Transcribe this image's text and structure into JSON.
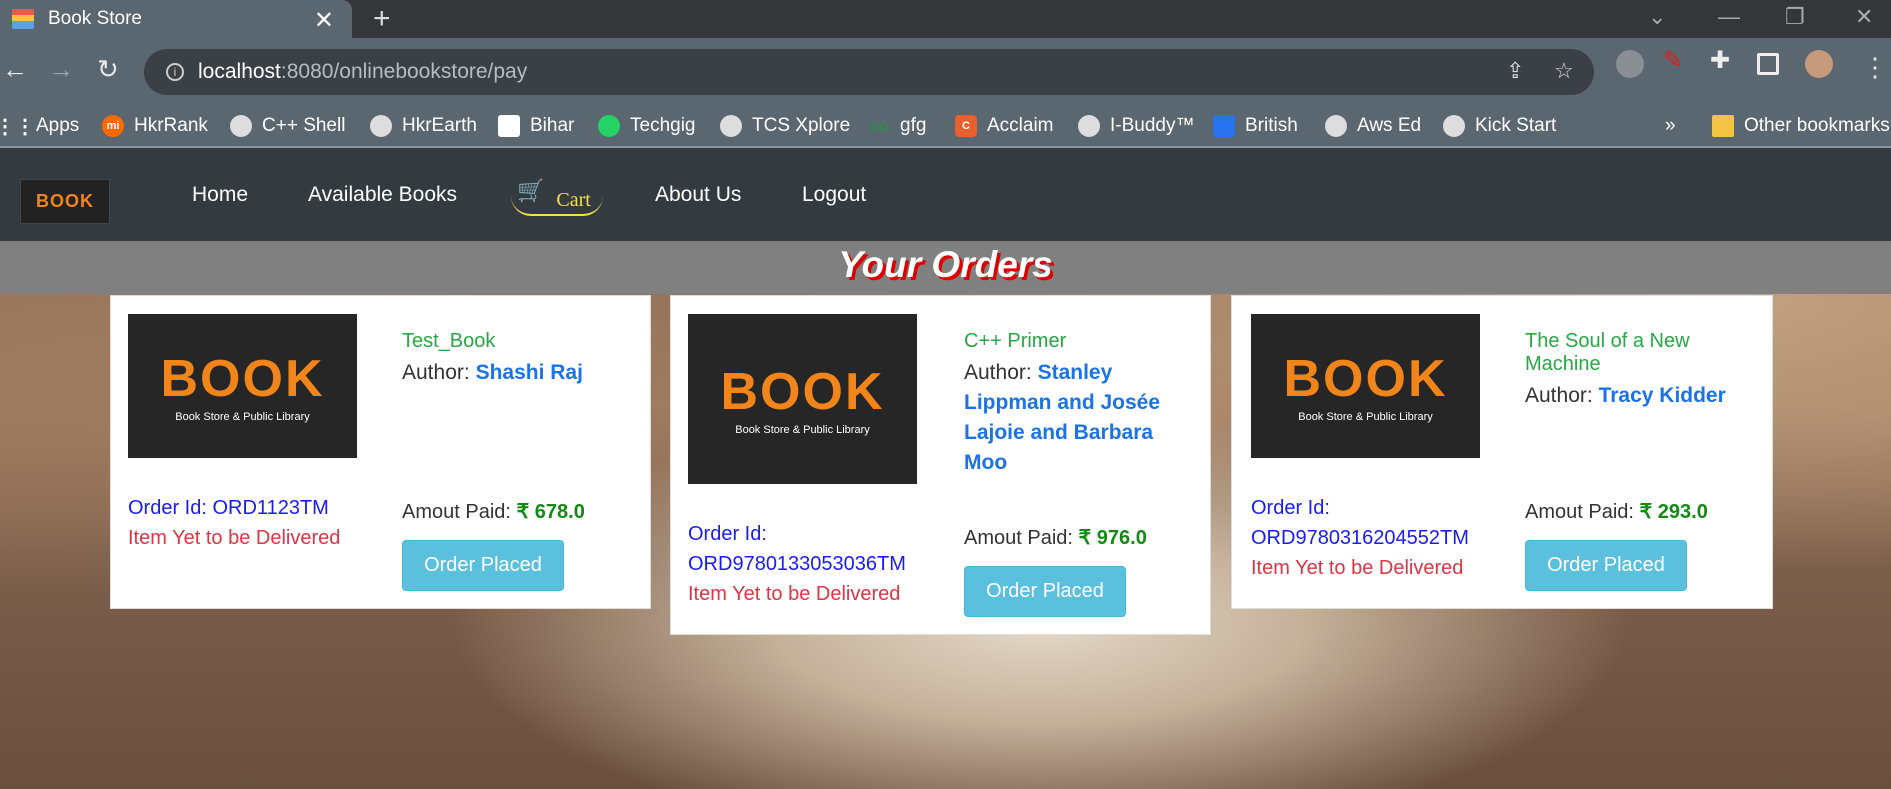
{
  "browser": {
    "tab_title": "Book Store",
    "url_host": "localhost",
    "url_path": ":8080/onlinebookstore/pay",
    "bookmarks": [
      "Apps",
      "HkrRank",
      "C++ Shell",
      "HkrEarth",
      "Bihar",
      "Techgig",
      "TCS Xplore",
      "gfg",
      "Acclaim",
      "I-Buddy™",
      "British",
      "Aws Ed",
      "Kick Start"
    ],
    "other_bookmarks": "Other bookmarks",
    "overflow": "»"
  },
  "site": {
    "logo_text": "BOOK",
    "menu": [
      "Home",
      "Available Books",
      "Cart",
      "About Us",
      "Logout"
    ]
  },
  "page_title": "Your Orders",
  "orders": [
    {
      "title": "Test_Book",
      "author_label": "Author:",
      "author": "Shashi Raj",
      "order_id_label": "Order Id:",
      "order_id": "ORD1123TM",
      "status": "Item Yet to be Delivered",
      "paid_label": "Amout Paid:",
      "amount": "₹ 678.0",
      "button": "Order Placed",
      "logo_text": "BOOK",
      "logo_sub": "Book Store & Public Library"
    },
    {
      "title": "C++ Primer",
      "author_label": "Author:",
      "author": "Stanley Lippman and Josée Lajoie and Barbara Moo",
      "order_id_label": "Order Id:",
      "order_id": "ORD9780133053036TM",
      "status": "Item Yet to be Delivered",
      "paid_label": "Amout Paid:",
      "amount": "₹ 976.0",
      "button": "Order Placed",
      "logo_text": "BOOK",
      "logo_sub": "Book Store & Public Library"
    },
    {
      "title": "The Soul of a New Machine",
      "author_label": "Author:",
      "author": "Tracy Kidder",
      "order_id_label": "Order Id:",
      "order_id": "ORD9780316204552TM",
      "status": "Item Yet to be Delivered",
      "paid_label": "Amout Paid:",
      "amount": "₹ 293.0",
      "button": "Order Placed",
      "logo_text": "BOOK",
      "logo_sub": "Book Store & Public Library"
    }
  ]
}
